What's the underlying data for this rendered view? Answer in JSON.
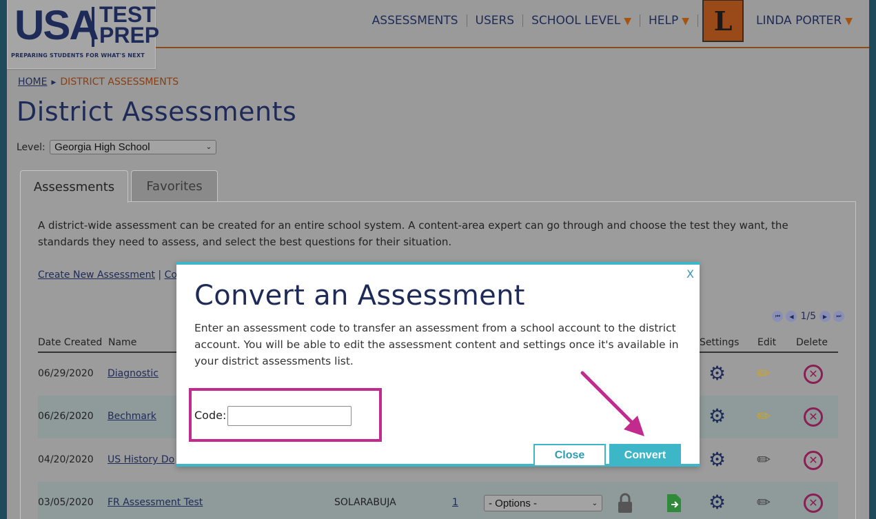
{
  "logo": {
    "usa": "USA",
    "test": "TEST",
    "prep": "PREP",
    "tagline": "PREPARING STUDENTS FOR WHAT'S NEXT"
  },
  "nav": {
    "assessments": "ASSESSMENTS",
    "users": "USERS",
    "school_level": "SCHOOL LEVEL",
    "help": "HELP",
    "avatar_letter": "L",
    "user_name": "LINDA PORTER"
  },
  "breadcrumb": {
    "home": "HOME",
    "current": "DISTRICT ASSESSMENTS"
  },
  "page_title": "District Assessments",
  "level": {
    "label": "Level:",
    "selected": "Georgia High School"
  },
  "tabs": [
    {
      "label": "Assessments"
    },
    {
      "label": "Favorites"
    }
  ],
  "intro_text": "A district-wide assessment can be created for an entire school system. A content-area expert can go through and choose the test they want, the standards they need to assess, and select the best questions for their situation.",
  "links": {
    "create": "Create New Assessment",
    "separator": "|",
    "convert_partial": "Co"
  },
  "pager": {
    "page": "1/5"
  },
  "table": {
    "headers": {
      "date": "Date Created",
      "name": "Name",
      "settings": "Settings",
      "edit": "Edit",
      "delete": "Delete"
    },
    "rows": [
      {
        "date": "06/29/2020",
        "name": "Diagnostic"
      },
      {
        "date": "06/26/2020",
        "name": "Bechmark"
      },
      {
        "date": "04/20/2020",
        "name": "US History Do"
      },
      {
        "date": "03/05/2020",
        "name": "FR Assessment Test",
        "author": "SOLARABUJA",
        "count": "1",
        "options": "- Options -"
      }
    ]
  },
  "modal": {
    "close_x": "X",
    "title": "Convert an Assessment",
    "text": "Enter an assessment code to transfer an assessment from a school account to the district account. You will be able to edit the assessment content and settings once it's available in your district assessments list.",
    "code_label": "Code:",
    "code_value": "",
    "close_button": "Close",
    "convert_button": "Convert"
  },
  "colors": {
    "navy": "#1e2a57",
    "accent_orange": "#a45410",
    "teal": "#3db6c8",
    "highlight": "#c22a8e"
  }
}
